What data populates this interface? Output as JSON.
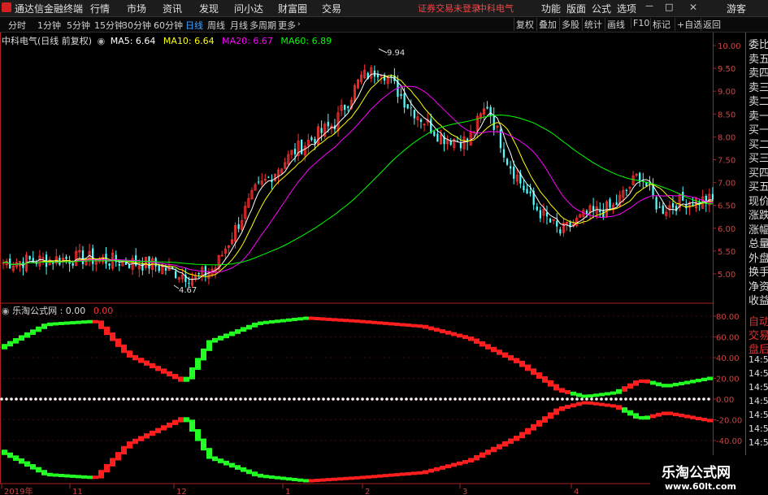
{
  "topbar": {
    "app_title": "通达信金融终端",
    "menus": [
      "行情",
      "市场",
      "资讯",
      "发现",
      "问小达",
      "财富圈",
      "交易"
    ],
    "login_status": "证券交易未登录",
    "stock_name": "中科电气",
    "right_menus": [
      "功能",
      "版面",
      "公式",
      "选项"
    ],
    "user": "游客"
  },
  "toolbar": {
    "periods": [
      "分时",
      "1分钟",
      "5分钟",
      "15分钟",
      "30分钟",
      "60分钟",
      "日线",
      "周线",
      "月线",
      "多周期",
      "更多"
    ],
    "active_period": "日线",
    "right_buttons": [
      "复权",
      "叠加",
      "多股",
      "统计",
      "画线",
      "F10",
      "标记",
      "+自选",
      "返回"
    ]
  },
  "main_chart": {
    "title": "中科电气(日线 前复权)",
    "ma5": "MA5: 6.64",
    "ma10": "MA10: 6.64",
    "ma20": "MA20: 6.67",
    "ma60": "MA60: 6.89",
    "high_label": "9.94",
    "low_label": "4.67",
    "y_ticks": [
      "10.00",
      "9.50",
      "9.00",
      "8.50",
      "8.00",
      "7.50",
      "7.00",
      "6.50",
      "6.00",
      "5.50",
      "5.00"
    ]
  },
  "sub_chart": {
    "title": "乐淘公式网",
    "value1": ": 0.00",
    "value2": "0.00",
    "y_ticks": [
      "80.00",
      "60.00",
      "40.00",
      "20.00",
      "0.00",
      "-20.00",
      "-40.00"
    ]
  },
  "x_axis": [
    "2019年",
    "11",
    "12",
    "1",
    "2",
    "3",
    "4"
  ],
  "right_panel": {
    "items": [
      "委比",
      "卖五",
      "卖四",
      "卖三",
      "卖二",
      "卖一",
      "买一",
      "买二",
      "买三",
      "买四",
      "买五",
      "现价",
      "涨跌",
      "涨幅",
      "总量",
      "外盘",
      "换手",
      "净资",
      "收益"
    ],
    "bottom_items": [
      "自动",
      "交易",
      "盘后",
      "14:56",
      "14:56",
      "14:56",
      "14:56",
      "14:56",
      "14:56",
      "14:56"
    ]
  },
  "watermark": {
    "title": "乐淘公式网",
    "url": "www.60lt.com"
  },
  "colors": {
    "up": "#ff3232",
    "down": "#54ffff",
    "ma5": "#ffffff",
    "ma10": "#ffff00",
    "ma20": "#ff00ff",
    "ma60": "#00ff00",
    "osc_up": "#ff1e1e",
    "osc_dn": "#22ff22"
  }
}
